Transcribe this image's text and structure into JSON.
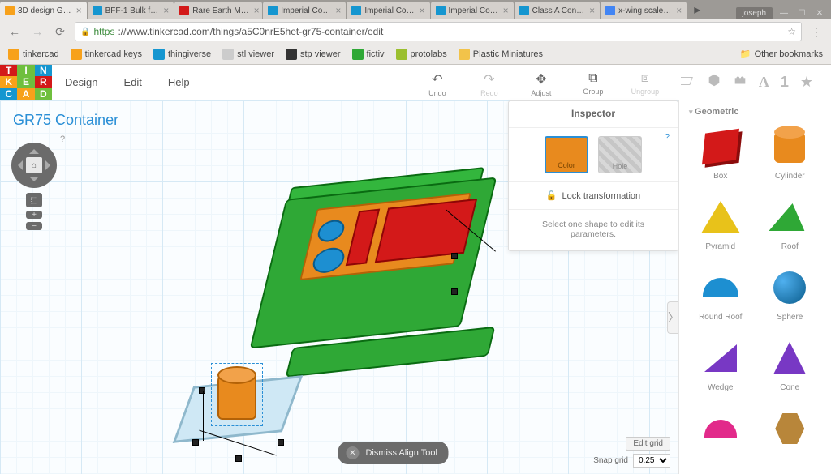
{
  "browser": {
    "tabs": [
      {
        "label": "3D design G…",
        "icon": "#f7a11b",
        "active": true
      },
      {
        "label": "BFF-1 Bulk f…",
        "icon": "#1596d0"
      },
      {
        "label": "Rare Earth M…",
        "icon": "#d31919"
      },
      {
        "label": "Imperial Co…",
        "icon": "#1596d0"
      },
      {
        "label": "Imperial Co…",
        "icon": "#1596d0"
      },
      {
        "label": "Imperial Co…",
        "icon": "#1596d0"
      },
      {
        "label": "Class A Con…",
        "icon": "#1596d0"
      },
      {
        "label": "x-wing scale…",
        "icon": "#4285f4"
      }
    ],
    "user": "joseph",
    "url_https": "https",
    "url_rest": "://www.tinkercad.com/things/a5C0nrE5het-gr75-container/edit",
    "bookmarks": [
      {
        "label": "tinkercad",
        "icon": "#f7a11b"
      },
      {
        "label": "tinkercad keys",
        "icon": "#f7a11b"
      },
      {
        "label": "thingiverse",
        "icon": "#1596d0"
      },
      {
        "label": "stl viewer",
        "icon": "#ccc"
      },
      {
        "label": "stp viewer",
        "icon": "#333"
      },
      {
        "label": "fictiv",
        "icon": "#2fa836"
      },
      {
        "label": "protolabs",
        "icon": "#9bbf2e"
      },
      {
        "label": "Plastic Miniatures",
        "icon": "#f2c34a"
      }
    ],
    "other_bookmarks": "Other bookmarks"
  },
  "app": {
    "logo_letters": [
      "T",
      "I",
      "N",
      "K",
      "E",
      "R",
      "C",
      "A",
      "D"
    ],
    "logo_colors": [
      "#d31919",
      "#6fbf3e",
      "#1596d0",
      "#f7a11b",
      "#6fbf3e",
      "#d31919",
      "#1596d0",
      "#f7a11b",
      "#6fbf3e"
    ],
    "menu": [
      "Design",
      "Edit",
      "Help"
    ],
    "tools": [
      {
        "label": "Undo",
        "icon": "↶",
        "disabled": false
      },
      {
        "label": "Redo",
        "icon": "↷",
        "disabled": true
      },
      {
        "label": "Adjust",
        "icon": "✥",
        "disabled": false
      },
      {
        "label": "Group",
        "icon": "⧉",
        "disabled": false
      },
      {
        "label": "Ungroup",
        "icon": "⧈",
        "disabled": true
      }
    ],
    "right_icons": [
      "workplane",
      "cube",
      "brick",
      "A",
      "1",
      "star"
    ]
  },
  "document": {
    "title": "GR75 Container"
  },
  "inspector": {
    "title": "Inspector",
    "color_label": "Color",
    "hole_label": "Hole",
    "lock_label": "Lock transformation",
    "message": "Select one shape to edit its parameters."
  },
  "shapelib": {
    "section": "Geometric",
    "shapes": [
      "Box",
      "Cylinder",
      "Pyramid",
      "Roof",
      "Round Roof",
      "Sphere",
      "Wedge",
      "Cone",
      "",
      ""
    ]
  },
  "bottom": {
    "dismiss": "Dismiss Align Tool",
    "edit_grid": "Edit grid",
    "snap_label": "Snap grid",
    "snap_value": "0.25"
  }
}
